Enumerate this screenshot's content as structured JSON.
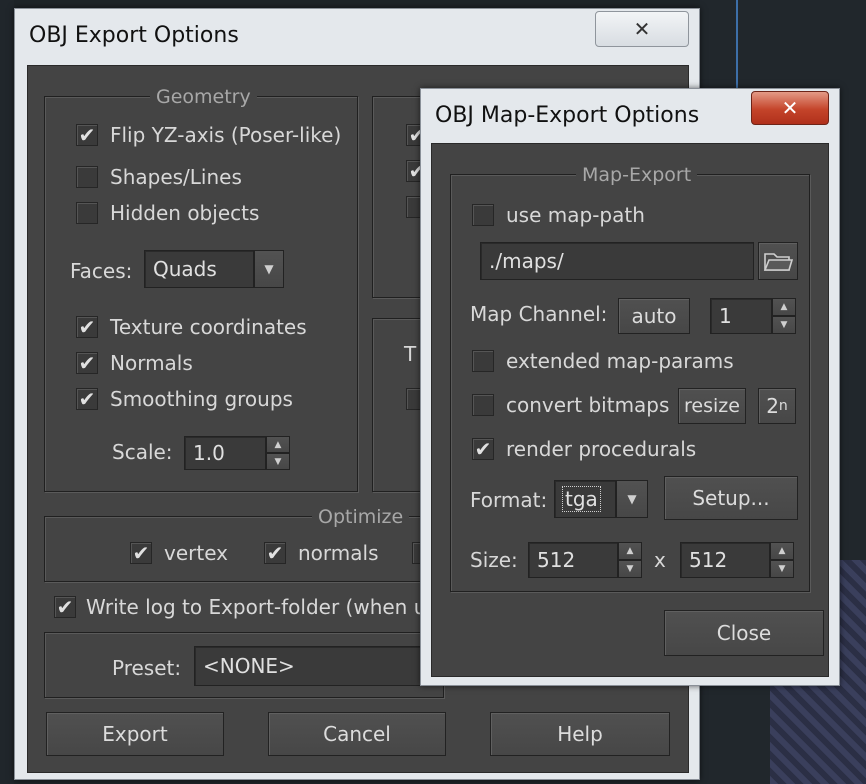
{
  "export_window": {
    "title": "OBJ Export Options",
    "close_glyph": "✕",
    "geometry": {
      "legend": "Geometry",
      "flip_yz": {
        "label": "Flip YZ-axis (Poser-like)",
        "checked": true
      },
      "shapes_lines": {
        "label": "Shapes/Lines",
        "checked": false
      },
      "hidden_objects": {
        "label": "Hidden objects",
        "checked": false
      },
      "faces_label": "Faces:",
      "faces_value": "Quads",
      "texture_coordinates": {
        "label": "Texture coordinates",
        "checked": true
      },
      "normals": {
        "label": "Normals",
        "checked": true
      },
      "smoothing_groups": {
        "label": "Smoothing groups",
        "checked": true
      },
      "scale_label": "Scale:",
      "scale_value": "1.0"
    },
    "partial_label_t": "T",
    "optimize": {
      "legend": "Optimize",
      "vertex": {
        "label": "vertex",
        "checked": true
      },
      "normals": {
        "label": "normals",
        "checked": true
      }
    },
    "write_log": {
      "label": "Write log to Export-folder (when us",
      "checked": true
    },
    "preset_label": "Preset:",
    "preset_value": "<NONE>",
    "buttons": {
      "export": "Export",
      "cancel": "Cancel",
      "help": "Help"
    }
  },
  "map_window": {
    "title": "OBJ Map-Export Options",
    "close_glyph": "✕",
    "legend": "Map-Export",
    "use_map_path": {
      "label": "use map-path",
      "checked": false
    },
    "map_path_value": "./maps/",
    "map_channel_label": "Map Channel:",
    "auto_label": "auto",
    "channel_value": "1",
    "extended_map_params": {
      "label": "extended map-params",
      "checked": false
    },
    "convert_bitmaps": {
      "label": "convert bitmaps",
      "checked": false
    },
    "resize_label": "resize",
    "pow2_label": "2",
    "pow2_sup": "n",
    "render_procedurals": {
      "label": "render procedurals",
      "checked": true
    },
    "format_label": "Format:",
    "format_value": "tga",
    "setup_label": "Setup...",
    "size_label": "Size:",
    "size_w": "512",
    "size_x": "x",
    "size_h": "512",
    "close_label": "Close"
  },
  "glyphs": {
    "check": "✔",
    "dropdown": "▼",
    "up": "▲",
    "down": "▼"
  },
  "colors": {
    "panel": "#444444",
    "titlebar": "#e4e8ec",
    "close_red": "#c4442a"
  }
}
